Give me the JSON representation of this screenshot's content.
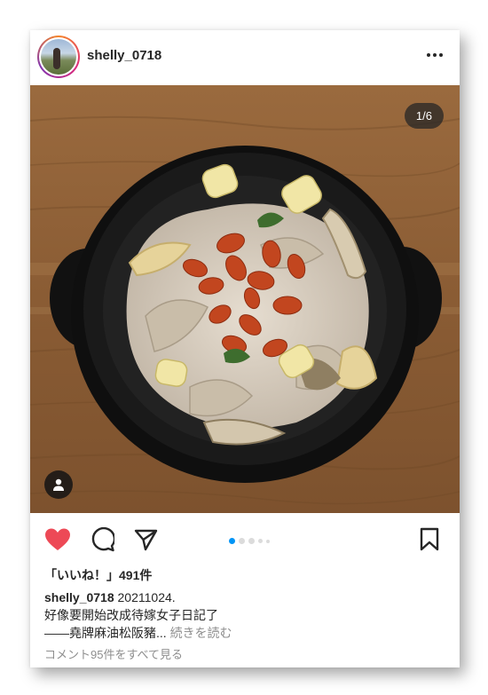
{
  "post": {
    "username": "shelly_0718",
    "image_counter": "1/6",
    "carousel": {
      "total_dots": 5,
      "active_index": 0
    },
    "liked": true,
    "like_color": "#ed4956",
    "likes_text": "「いいね！」491件",
    "caption": {
      "username": "shelly_0718",
      "first_line": "20211024.",
      "second_line": "好像要開始改成待嫁女子日記了",
      "third_line": "——堯牌麻油松阪豬...",
      "more_label": "続きを読む"
    },
    "comments_link": "コメント95件をすべて見る"
  },
  "icons": {
    "more": "more-horizontal-icon",
    "heart": "heart-filled-icon",
    "comment": "comment-icon",
    "share": "paper-plane-icon",
    "save": "bookmark-icon",
    "user_tag": "user-tag-icon"
  }
}
